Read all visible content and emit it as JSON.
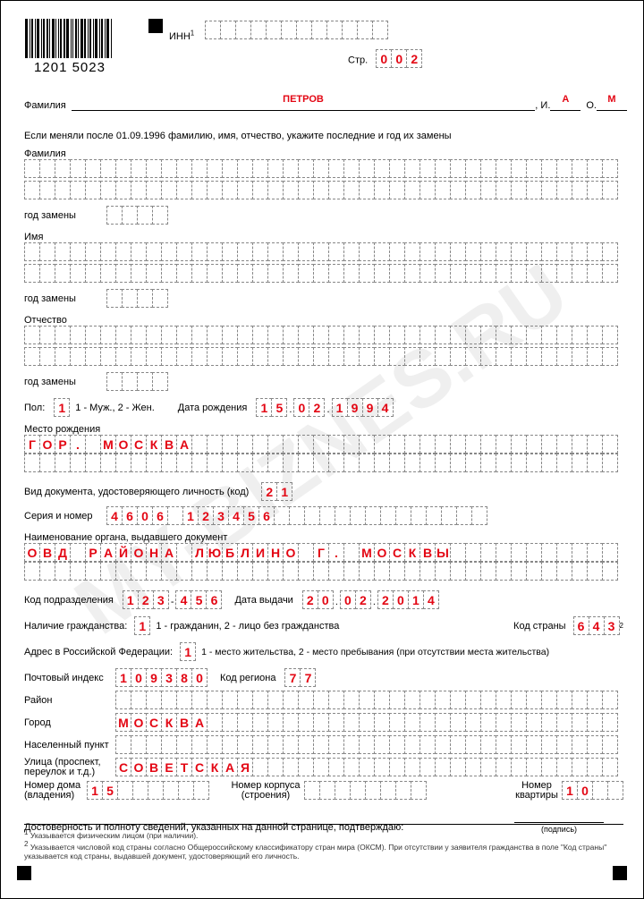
{
  "barcode_number": "1201 5023",
  "inn_label": "ИНН",
  "page_label": "Стр.",
  "page_number": [
    "0",
    "0",
    "2"
  ],
  "surname_label": "Фамилия",
  "surname_value": "ПЕТРОВ",
  "initial_i_label": ", И.",
  "initial_i": "А",
  "initial_o_label": "О.",
  "initial_o": "М",
  "intro_text": "Если меняли после 01.09.1996 фамилию, имя, отчество, укажите последние и год их замены",
  "prev_surname_label": "Фамилия",
  "year_change_label": "год замены",
  "prev_name_label": "Имя",
  "prev_patronymic_label": "Отчество",
  "sex_label": "Пол:",
  "sex_value": "1",
  "sex_hint": "1 - Муж., 2 - Жен.",
  "dob_label": "Дата рождения",
  "dob": [
    "1",
    "5",
    ".",
    "0",
    "2",
    ".",
    "1",
    "9",
    "9",
    "4"
  ],
  "pob_label": "Место рождения",
  "pob_value": "ГОР. МОСКВА",
  "doc_type_label": "Вид документа, удостоверяющего личность (код)",
  "doc_type": [
    "2",
    "1"
  ],
  "series_label": "Серия и номер",
  "series_value": "4606 123456",
  "issuer_label": "Наименование органа, выдавшего документ",
  "issuer_value": "ОВД РАЙОНА ЛЮБЛИНО Г. МОСКВЫ",
  "dept_code_label": "Код подразделения",
  "dept_code": [
    "1",
    "2",
    "3",
    "-",
    "4",
    "5",
    "6"
  ],
  "issue_date_label": "Дата выдачи",
  "issue_date": [
    "2",
    "0",
    ".",
    "0",
    "2",
    ".",
    "2",
    "0",
    "1",
    "4"
  ],
  "citizenship_label": "Наличие гражданства:",
  "citizenship_value": "1",
  "citizenship_hint": "1 - гражданин, 2 - лицо без гражданства",
  "country_code_label": "Код страны",
  "country_code": [
    "6",
    "4",
    "3"
  ],
  "address_type_label": "Адрес в Российской Федерации:",
  "address_type_value": "1",
  "address_type_hint": "1 - место жительства, 2 - место пребывания (при отсутствии места жительства)",
  "postal_label": "Почтовый индекс",
  "postal_value": "109380",
  "region_label": "Код региона",
  "region_value": [
    "7",
    "7"
  ],
  "district_label": "Район",
  "city_label": "Город",
  "city_value": "МОСКВА",
  "settlement_label": "Населенный пункт",
  "street_label_1": "Улица (проспект,",
  "street_label_2": "переулок и т.д.)",
  "street_value": "СОВЕТСКАЯ",
  "house_label_1": "Номер дома",
  "house_label_2": "(владения)",
  "house_value": [
    "1",
    "5"
  ],
  "korpus_label_1": "Номер корпуса",
  "korpus_label_2": "(строения)",
  "flat_label_1": "Номер",
  "flat_label_2": "квартиры",
  "flat_value": [
    "1",
    "0"
  ],
  "confirm_text": "Достоверность и полноту сведений, указанных на данной странице, подтверждаю:",
  "signature_label": "(подпись)",
  "footnote1": "Указывается физическим лицом (при наличии).",
  "footnote2": "Указывается числовой код страны согласно Общероссийскому классификатору стран мира (ОКСМ). При отсутствии у заявителя гражданства в поле \"Код страны\" указывается код страны, выдавшей документ, удостоверяющий его личность.",
  "watermark": "MY-BIZNES.RU"
}
